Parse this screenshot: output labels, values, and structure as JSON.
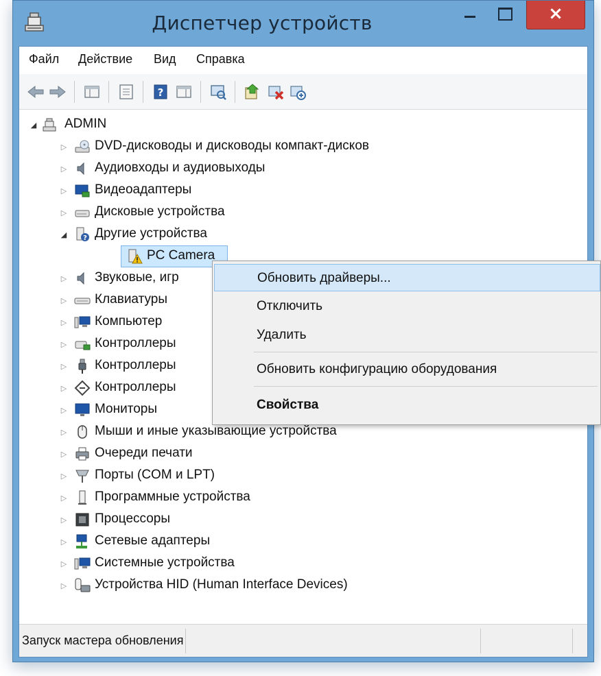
{
  "window": {
    "title": "Диспетчер устройств",
    "close_glyph": "×"
  },
  "menu": [
    "Файл",
    "Действие",
    "Вид",
    "Справка"
  ],
  "toolbar": {
    "icons": [
      "back-arrow-icon",
      "forward-arrow-icon",
      "console-tree-icon",
      "properties-icon",
      "help-icon",
      "action-pane-icon",
      "scan-hardware-icon",
      "update-driver-icon",
      "uninstall-device-icon",
      "disable-device-icon"
    ]
  },
  "tree": {
    "root": "ADMIN",
    "categories": [
      "DVD-дисководы и дисководы компакт-дисков",
      "Аудиовходы и аудиовыходы",
      "Видеоадаптеры",
      "Дисковые устройства",
      "Другие устройства",
      "PC Camera",
      "Звуковые, игр",
      "Клавиатуры",
      "Компьютер",
      "Контроллеры",
      "Контроллеры",
      "Контроллеры",
      "Мониторы",
      "Мыши и иные указывающие устройства",
      "Очереди печати",
      "Порты (COM и LPT)",
      "Программные устройства",
      "Процессоры",
      "Сетевые адаптеры",
      "Системные устройства",
      "Устройства HID (Human Interface Devices)"
    ]
  },
  "context_menu": {
    "items": [
      "Обновить драйверы...",
      "Отключить",
      "Удалить",
      "Обновить конфигурацию оборудования",
      "Свойства"
    ]
  },
  "status": {
    "text": "Запуск мастера обновления драйвер"
  },
  "colors": {
    "titlebar": "#6fa8d6",
    "close": "#c9433c",
    "selection": "#cce8ff",
    "menu_highlight": "#d5e8f9"
  }
}
